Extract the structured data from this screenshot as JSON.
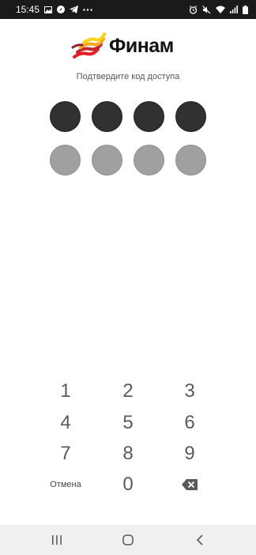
{
  "status_bar": {
    "time": "15:45",
    "left_icons": [
      "image-icon",
      "compass-icon",
      "telegram-icon",
      "more-icon"
    ],
    "right_icons": [
      "alarm-icon",
      "mute-icon",
      "wifi-icon",
      "signal-icon",
      "battery-icon"
    ]
  },
  "logo": {
    "text": "Финам"
  },
  "prompt": "Подтвердите код доступа",
  "pin": {
    "entered": [
      true,
      true,
      true,
      true
    ],
    "confirm": [
      false,
      false,
      false,
      false
    ]
  },
  "keypad": {
    "keys": [
      "1",
      "2",
      "3",
      "4",
      "5",
      "6",
      "7",
      "8",
      "9"
    ],
    "cancel": "Отмена",
    "zero": "0",
    "backspace_icon": "backspace-icon"
  },
  "nav_bar": {
    "icons": [
      "recent-apps-icon",
      "home-icon",
      "back-icon"
    ]
  }
}
